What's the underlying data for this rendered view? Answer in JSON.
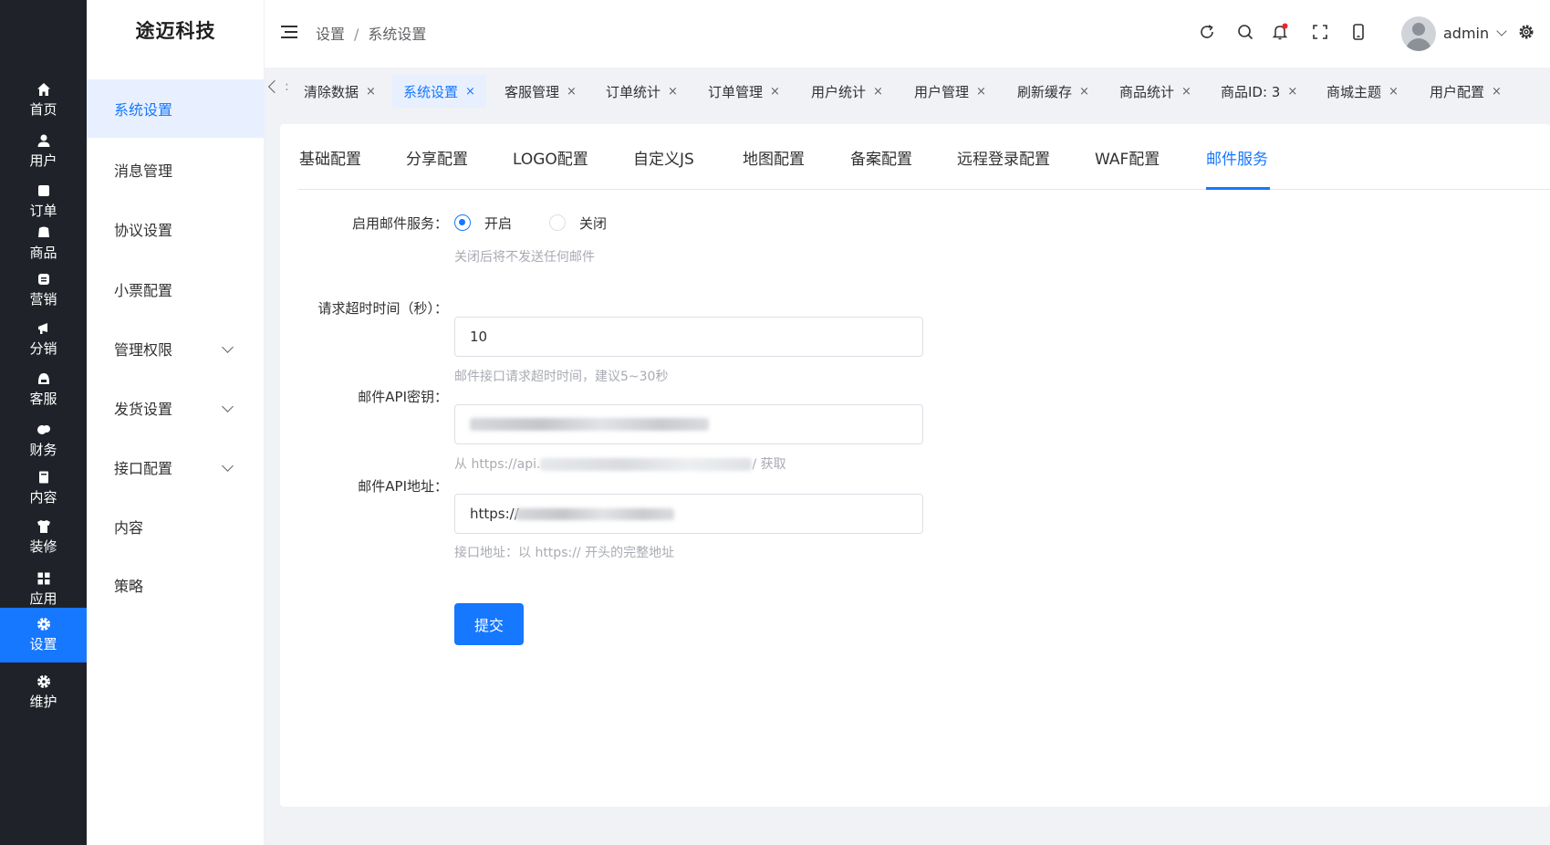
{
  "brand": "途迈科技",
  "rail": [
    {
      "label": "首页",
      "icon": "home-icon"
    },
    {
      "label": "用户",
      "icon": "user-icon"
    },
    {
      "label": "订单",
      "icon": "order-icon"
    },
    {
      "label": "商品",
      "icon": "product-icon"
    },
    {
      "label": "营销",
      "icon": "marketing-icon"
    },
    {
      "label": "分销",
      "icon": "distribution-icon"
    },
    {
      "label": "客服",
      "icon": "customer-service-icon"
    },
    {
      "label": "财务",
      "icon": "finance-icon"
    },
    {
      "label": "内容",
      "icon": "content-icon"
    },
    {
      "label": "装修",
      "icon": "decoration-icon"
    },
    {
      "label": "应用",
      "icon": "apps-icon"
    },
    {
      "label": "设置",
      "icon": "gear-icon"
    },
    {
      "label": "维护",
      "icon": "maintenance-gear-icon"
    }
  ],
  "sidebar": [
    {
      "label": "系统设置"
    },
    {
      "label": "消息管理"
    },
    {
      "label": "协议设置"
    },
    {
      "label": "小票配置"
    },
    {
      "label": "管理权限"
    },
    {
      "label": "发货设置"
    },
    {
      "label": "接口配置"
    },
    {
      "label": "内容"
    },
    {
      "label": "策略"
    }
  ],
  "header": {
    "breadcrumb": [
      "设置",
      "系统设置"
    ],
    "breadcrumb_sep": "/",
    "user": "admin"
  },
  "tabs": [
    {
      "label": "清除数据"
    },
    {
      "label": "系统设置"
    },
    {
      "label": "客服管理"
    },
    {
      "label": "订单统计"
    },
    {
      "label": "订单管理"
    },
    {
      "label": "用户统计"
    },
    {
      "label": "用户管理"
    },
    {
      "label": "刷新缓存"
    },
    {
      "label": "商品统计"
    },
    {
      "label": "商品ID: 3"
    },
    {
      "label": "商城主题"
    },
    {
      "label": "用户配置"
    }
  ],
  "tabs_colon": ":",
  "close_glyph": "×",
  "settings_tabs": [
    {
      "label": "基础配置"
    },
    {
      "label": "分享配置"
    },
    {
      "label": "LOGO配置"
    },
    {
      "label": "自定义JS"
    },
    {
      "label": "地图配置"
    },
    {
      "label": "备案配置"
    },
    {
      "label": "远程登录配置"
    },
    {
      "label": "WAF配置"
    },
    {
      "label": "邮件服务"
    }
  ],
  "form": {
    "enable": {
      "label": "启用邮件服务：",
      "options": [
        "开启",
        "关闭"
      ],
      "selected": "开启",
      "hint": "关闭后将不发送任何邮件"
    },
    "timeout": {
      "label": "请求超时时间（秒）：",
      "value": "10",
      "hint": "邮件接口请求超时时间，建议5~30秒"
    },
    "api_key": {
      "label": "邮件API密钥：",
      "hint_prefix": "从 https://api.",
      "hint_suffix": "/ 获取"
    },
    "api_url": {
      "label": "邮件API地址：",
      "value_prefix": "https://",
      "hint": "接口地址：以 https:// 开头的完整地址"
    },
    "submit": "提交"
  },
  "colors": {
    "primary": "#1677ff",
    "rail_bg": "#1f2329",
    "notification_dot": "#f5222d"
  }
}
